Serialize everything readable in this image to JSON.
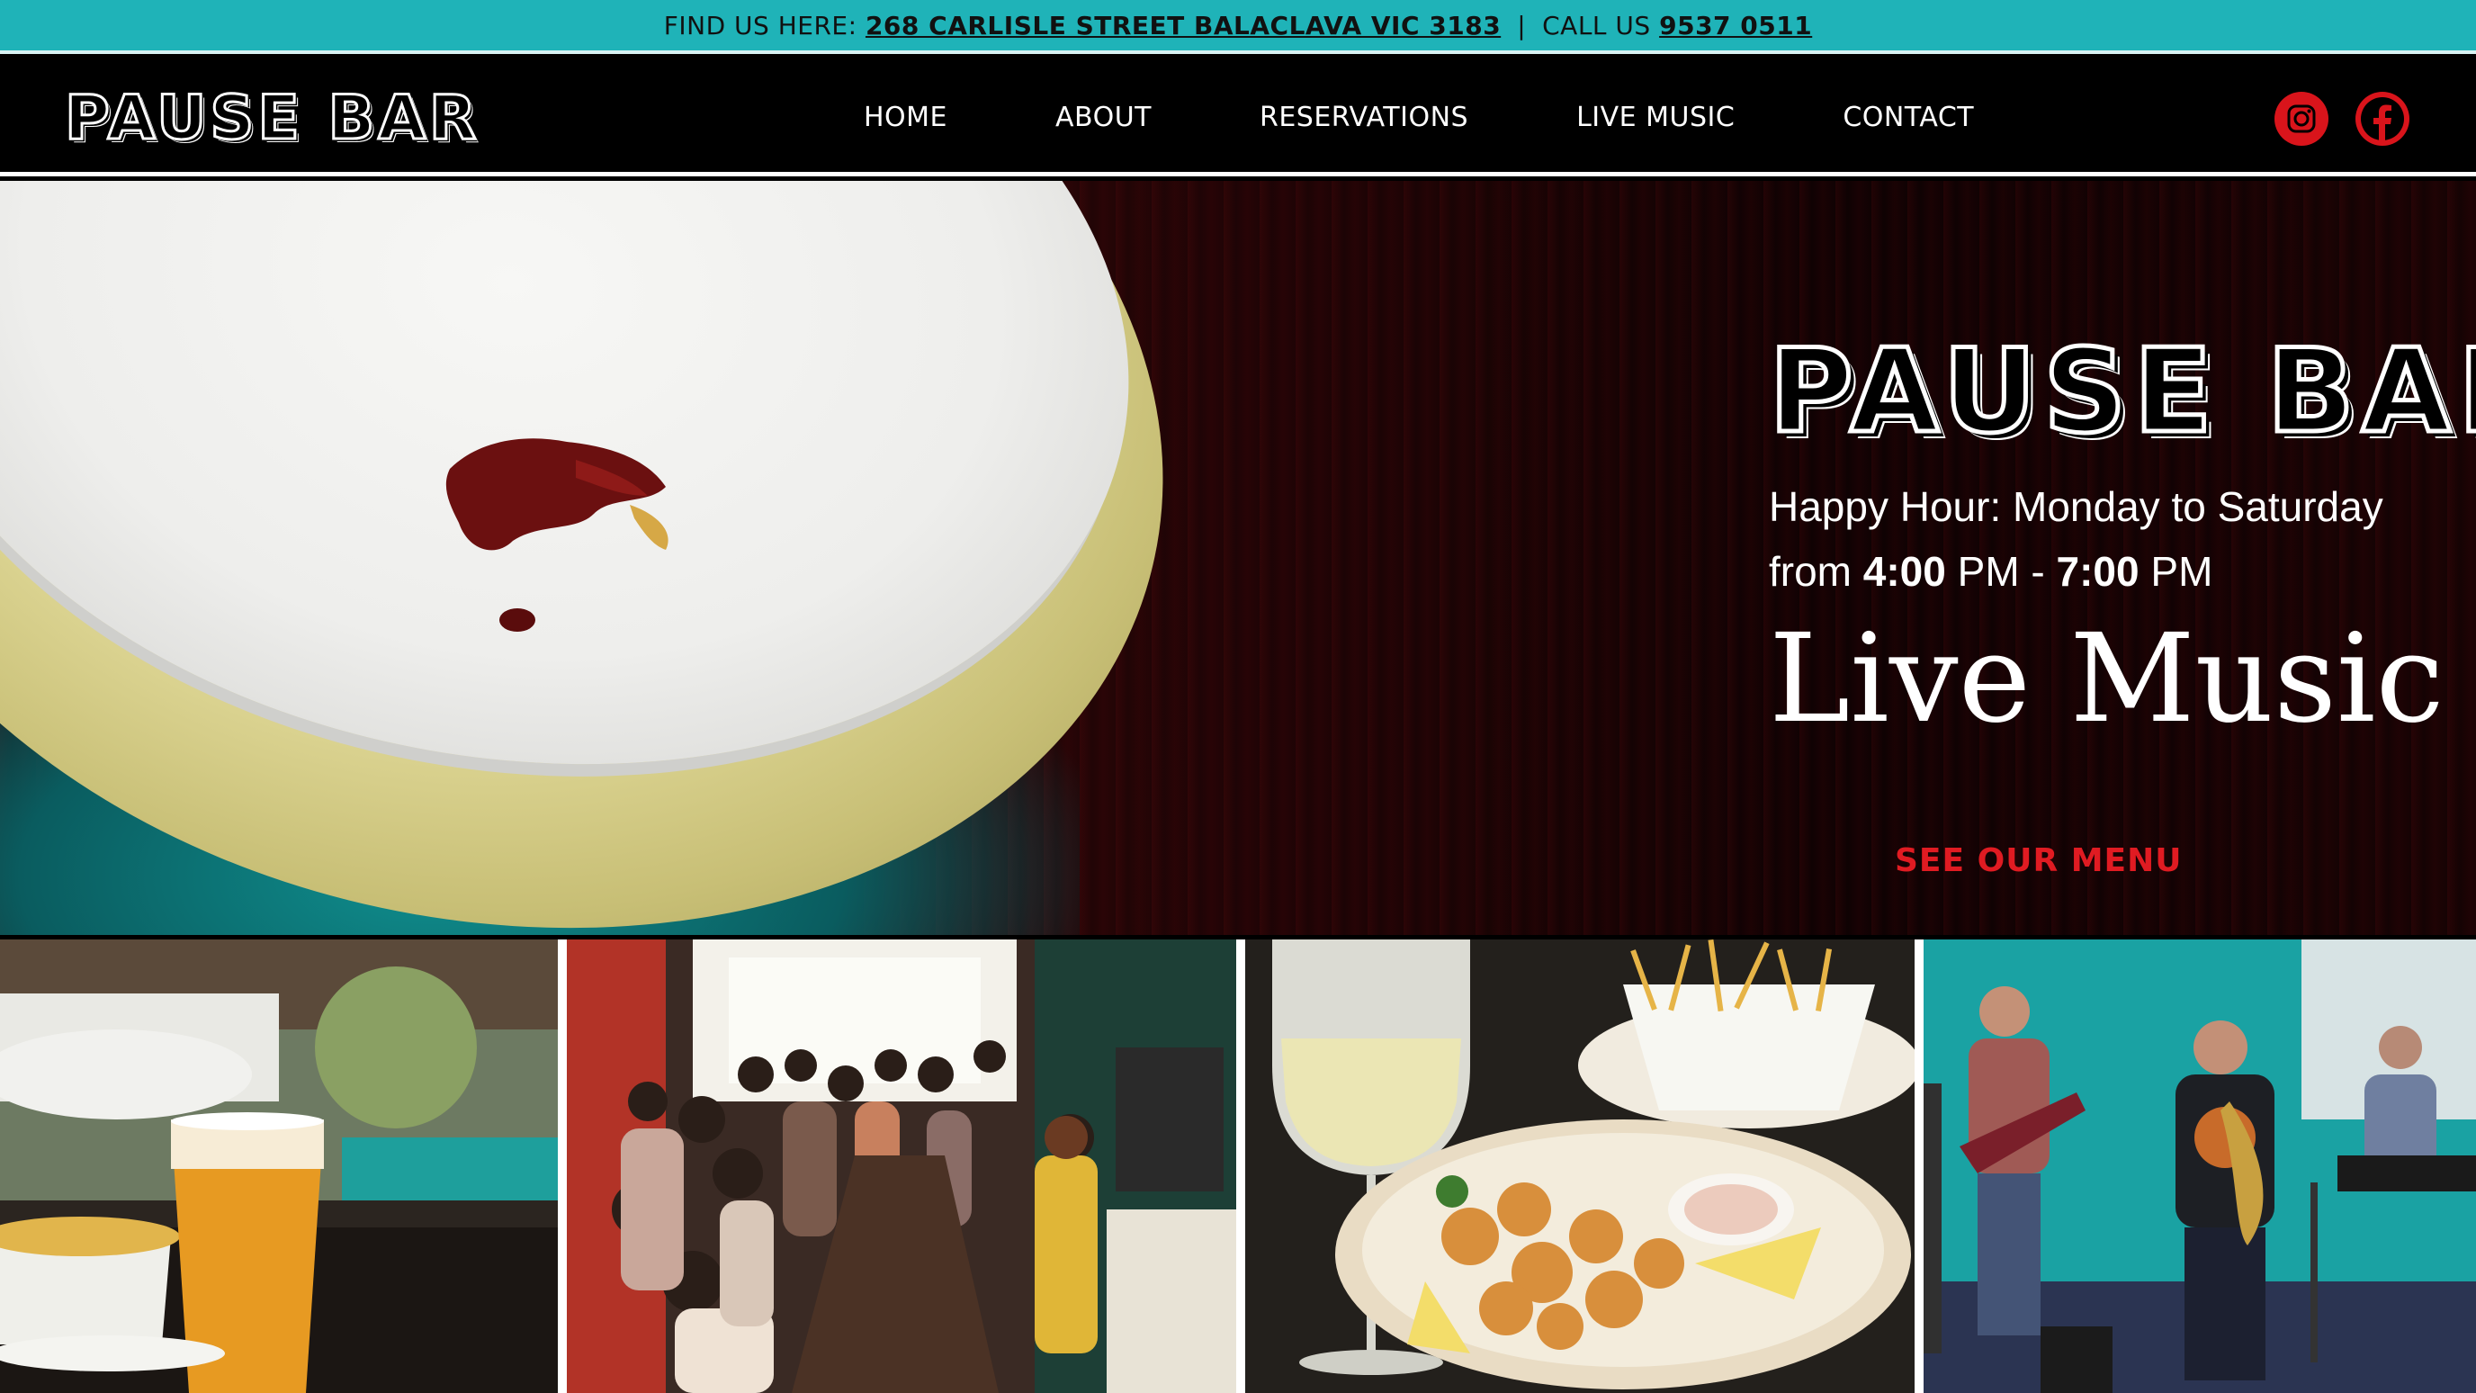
{
  "topbar": {
    "find_label": "FIND US HERE:",
    "address": "268 CARLISLE STREET BALACLAVA VIC 3183",
    "separator": "|",
    "call_label": "CALL US",
    "phone": "9537 0511"
  },
  "header": {
    "logo": "PAUSE BAR",
    "nav": [
      "HOME",
      "ABOUT",
      "RESERVATIONS",
      "LIVE MUSIC",
      "CONTACT"
    ],
    "social": [
      "instagram-icon",
      "facebook-icon"
    ]
  },
  "hero": {
    "logo": "PAUSE BAR",
    "happy_line1": "Happy Hour: Monday to Saturday",
    "happy_from": "from",
    "happy_start": "4:00",
    "happy_pm1": "PM -",
    "happy_end": "7:00",
    "happy_pm2": "PM",
    "live_music": "Live Music",
    "menu_cta": "SEE OUR MENU"
  },
  "colors": {
    "topbar": "#1fb3b8",
    "accent_red": "#e01b22",
    "social_red": "#d9141b"
  },
  "gallery": {
    "tiles": [
      "beer-and-fries-photo",
      "crowded-bar-photo",
      "wine-and-calamari-photo",
      "live-band-photo"
    ]
  }
}
